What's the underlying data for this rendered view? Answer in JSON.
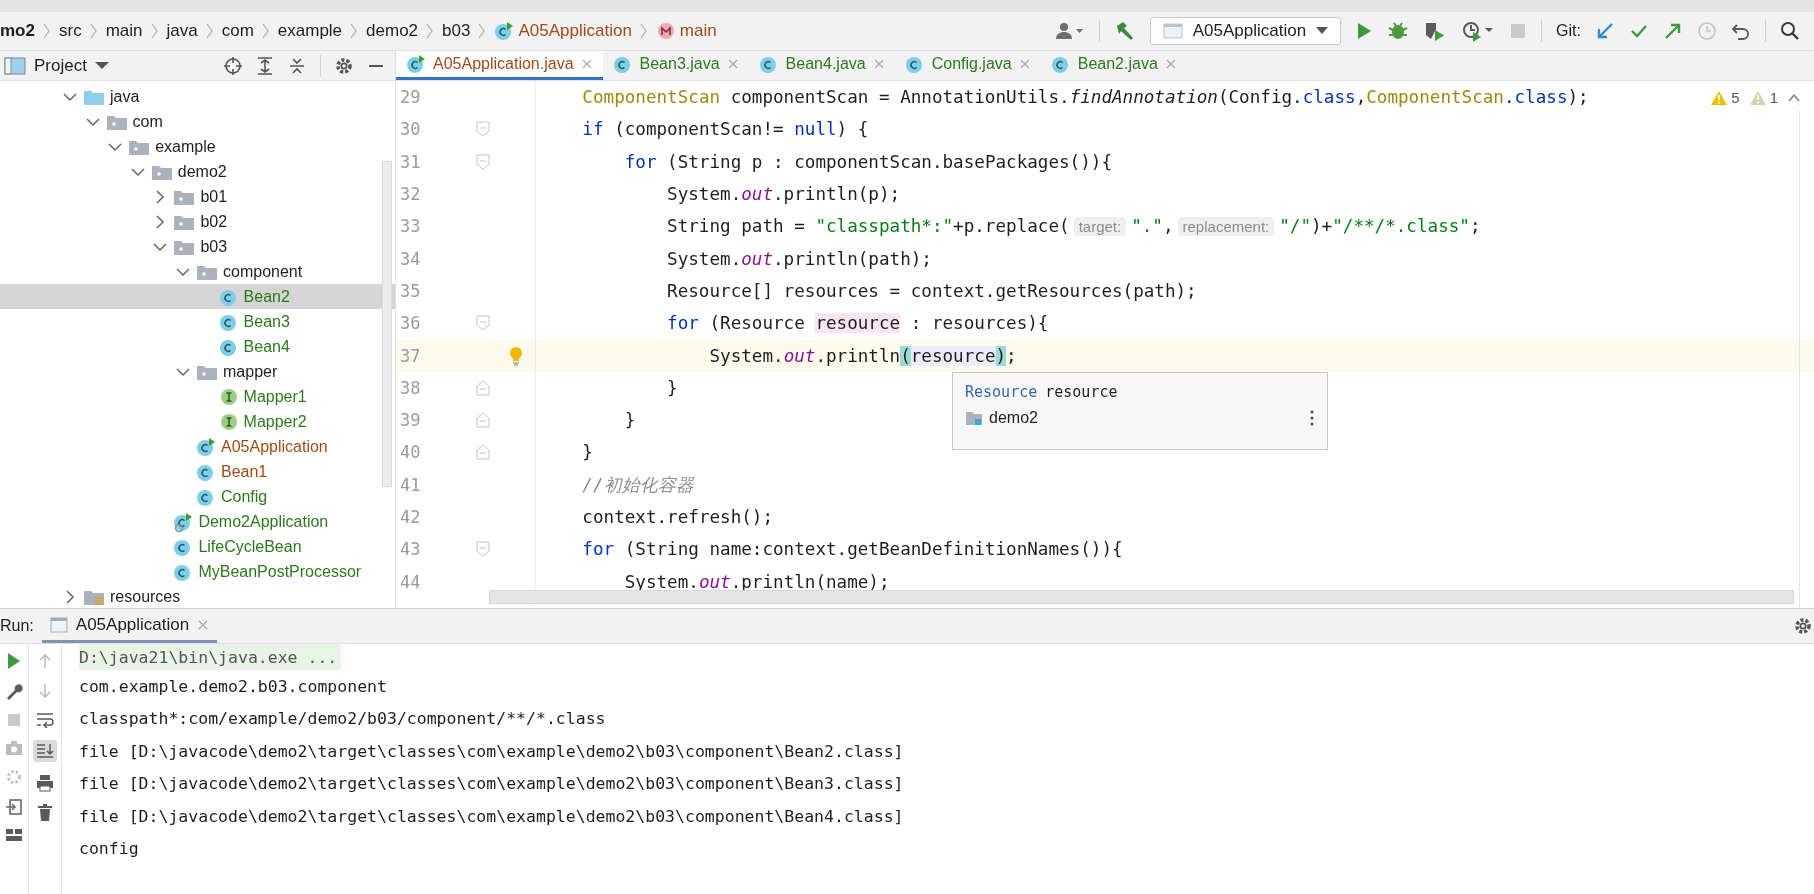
{
  "breadcrumbs": [
    {
      "label": "mo2",
      "kind": "module"
    },
    {
      "label": "src",
      "kind": "folder"
    },
    {
      "label": "main",
      "kind": "folder"
    },
    {
      "label": "java",
      "kind": "folder"
    },
    {
      "label": "com",
      "kind": "folder"
    },
    {
      "label": "example",
      "kind": "folder"
    },
    {
      "label": "demo2",
      "kind": "folder"
    },
    {
      "label": "b03",
      "kind": "folder"
    },
    {
      "label": "A05Application",
      "kind": "class"
    },
    {
      "label": "main",
      "kind": "method"
    }
  ],
  "toolbar": {
    "run_config": "A05Application",
    "git_label": "Git:"
  },
  "project_panel": {
    "title": "Project"
  },
  "tabs": [
    {
      "label": "A05Application.java",
      "selected": true,
      "color": "#a14a16"
    },
    {
      "label": "Bean3.java",
      "selected": false,
      "color": "#2a7a1a"
    },
    {
      "label": "Bean4.java",
      "selected": false,
      "color": "#2a7a1a"
    },
    {
      "label": "Config.java",
      "selected": false,
      "color": "#2a7a1a"
    },
    {
      "label": "Bean2.java",
      "selected": false,
      "color": "#2a7a1a"
    }
  ],
  "tree": [
    {
      "label": "java",
      "kind": "source-folder",
      "expanded": true,
      "selected": false,
      "children": [
        {
          "label": "com",
          "kind": "package",
          "expanded": true,
          "selected": false,
          "children": [
            {
              "label": "example",
              "kind": "package",
              "expanded": true,
              "selected": false,
              "children": [
                {
                  "label": "demo2",
                  "kind": "package",
                  "expanded": true,
                  "selected": false,
                  "children": [
                    {
                      "label": "b01",
                      "kind": "package",
                      "expanded": false,
                      "selected": false
                    },
                    {
                      "label": "b02",
                      "kind": "package",
                      "expanded": false,
                      "selected": false
                    },
                    {
                      "label": "b03",
                      "kind": "package",
                      "expanded": true,
                      "selected": false,
                      "children": [
                        {
                          "label": "component",
                          "kind": "package",
                          "expanded": true,
                          "selected": false,
                          "children": [
                            {
                              "label": "Bean2",
                              "kind": "class",
                              "color": "#2a7a1a",
                              "selected": true
                            },
                            {
                              "label": "Bean3",
                              "kind": "class",
                              "color": "#2a7a1a",
                              "selected": false
                            },
                            {
                              "label": "Bean4",
                              "kind": "class",
                              "color": "#2a7a1a",
                              "selected": false
                            }
                          ]
                        },
                        {
                          "label": "mapper",
                          "kind": "package",
                          "expanded": true,
                          "selected": false,
                          "children": [
                            {
                              "label": "Mapper1",
                              "kind": "interface",
                              "color": "#2a7a1a",
                              "selected": false
                            },
                            {
                              "label": "Mapper2",
                              "kind": "interface",
                              "color": "#2a7a1a",
                              "selected": false
                            }
                          ]
                        },
                        {
                          "label": "A05Application",
                          "kind": "main-class",
                          "color": "#a14a16",
                          "selected": false
                        },
                        {
                          "label": "Bean1",
                          "kind": "class",
                          "color": "#a14a16",
                          "selected": false
                        },
                        {
                          "label": "Config",
                          "kind": "class",
                          "color": "#2a7a1a",
                          "selected": false
                        }
                      ]
                    },
                    {
                      "label": "Demo2Application",
                      "kind": "boot-class",
                      "color": "#2a7a1a",
                      "selected": false
                    },
                    {
                      "label": "LifeCycleBean",
                      "kind": "class",
                      "color": "#2a7a1a",
                      "selected": false
                    },
                    {
                      "label": "MyBeanPostProcessor",
                      "kind": "class",
                      "color": "#2a7a1a",
                      "selected": false
                    }
                  ]
                }
              ]
            }
          ]
        }
      ]
    },
    {
      "label": "resources",
      "kind": "resources-folder",
      "expanded": false,
      "selected": false
    }
  ],
  "editor": {
    "inspections": [
      {
        "kind": "warning",
        "count": "5"
      },
      {
        "kind": "weak-warning",
        "count": "1"
      }
    ],
    "lines": [
      {
        "number": "29",
        "current": false,
        "fold_start": false,
        "fold_end": false,
        "tokens": [
          {
            "kind": "type",
            "text": "ComponentScan"
          },
          {
            "kind": "plain",
            "text": " componentScan = AnnotationUtils."
          },
          {
            "kind": "italic",
            "text": "findAnnotation"
          },
          {
            "kind": "plain",
            "text": "(Config."
          },
          {
            "kind": "keyword",
            "text": "class"
          },
          {
            "kind": "plain",
            "text": ","
          },
          {
            "kind": "type",
            "text": "ComponentScan"
          },
          {
            "kind": "plain",
            "text": "."
          },
          {
            "kind": "keyword",
            "text": "class"
          },
          {
            "kind": "plain",
            "text": ");"
          }
        ]
      },
      {
        "number": "30",
        "current": false,
        "fold_start": true,
        "fold_end": false,
        "tokens": [
          {
            "kind": "keyword",
            "text": "if"
          },
          {
            "kind": "plain",
            "text": " (componentScan!= "
          },
          {
            "kind": "keyword",
            "text": "null"
          },
          {
            "kind": "plain",
            "text": ") {"
          }
        ]
      },
      {
        "number": "31",
        "current": false,
        "fold_start": true,
        "fold_end": false,
        "tokens": [
          {
            "kind": "keyword",
            "text": "for"
          },
          {
            "kind": "plain",
            "text": " (String p : componentScan.basePackages()){"
          }
        ]
      },
      {
        "number": "32",
        "current": false,
        "fold_start": false,
        "fold_end": false,
        "tokens": [
          {
            "kind": "plain",
            "text": "System."
          },
          {
            "kind": "static",
            "text": "out"
          },
          {
            "kind": "plain",
            "text": ".println(p);"
          }
        ]
      },
      {
        "number": "33",
        "current": false,
        "fold_start": false,
        "fold_end": false,
        "tokens": [
          {
            "kind": "plain",
            "text": "String path = "
          },
          {
            "kind": "string",
            "text": "\"classpath*:\""
          },
          {
            "kind": "plain",
            "text": "+p.replace("
          },
          {
            "kind": "hint",
            "text": "target:"
          },
          {
            "kind": "string",
            "text": "\".\""
          },
          {
            "kind": "plain",
            "text": ","
          },
          {
            "kind": "hint",
            "text": "replacement:"
          },
          {
            "kind": "string",
            "text": "\"/\""
          },
          {
            "kind": "plain",
            "text": ")+"
          },
          {
            "kind": "string",
            "text": "\"/**/*.class\""
          },
          {
            "kind": "plain",
            "text": ";"
          }
        ]
      },
      {
        "number": "34",
        "current": false,
        "fold_start": false,
        "fold_end": false,
        "tokens": [
          {
            "kind": "plain",
            "text": "System."
          },
          {
            "kind": "static",
            "text": "out"
          },
          {
            "kind": "plain",
            "text": ".println(path);"
          }
        ]
      },
      {
        "number": "35",
        "current": false,
        "fold_start": false,
        "fold_end": false,
        "tokens": [
          {
            "kind": "plain",
            "text": "Resource[] resources = context.getResources(path);"
          }
        ]
      },
      {
        "number": "36",
        "current": false,
        "fold_start": true,
        "fold_end": false,
        "tokens": [
          {
            "kind": "keyword",
            "text": "for"
          },
          {
            "kind": "plain",
            "text": " (Resource "
          },
          {
            "kind": "write",
            "text": "resource"
          },
          {
            "kind": "plain",
            "text": " : resources){"
          }
        ]
      },
      {
        "number": "37",
        "current": true,
        "fold_start": false,
        "fold_end": false,
        "tokens": [
          {
            "kind": "plain",
            "text": "System."
          },
          {
            "kind": "static",
            "text": "out"
          },
          {
            "kind": "plain",
            "text": ".println"
          },
          {
            "kind": "brace",
            "text": "("
          },
          {
            "kind": "read",
            "text": "resource"
          },
          {
            "kind": "brace",
            "text": ")"
          },
          {
            "kind": "plain",
            "text": ";"
          }
        ]
      },
      {
        "number": "38",
        "current": false,
        "fold_start": false,
        "fold_end": true,
        "tokens": [
          {
            "kind": "plain",
            "text": "}"
          }
        ]
      },
      {
        "number": "39",
        "current": false,
        "fold_start": false,
        "fold_end": true,
        "tokens": [
          {
            "kind": "plain",
            "text": "}"
          }
        ]
      },
      {
        "number": "40",
        "current": false,
        "fold_start": false,
        "fold_end": true,
        "tokens": [
          {
            "kind": "plain",
            "text": "}"
          }
        ]
      },
      {
        "number": "41",
        "current": false,
        "fold_start": false,
        "fold_end": false,
        "tokens": [
          {
            "kind": "comment",
            "text": "//初始化容器"
          }
        ]
      },
      {
        "number": "42",
        "current": false,
        "fold_start": false,
        "fold_end": false,
        "tokens": [
          {
            "kind": "plain",
            "text": "context.refresh();"
          }
        ]
      },
      {
        "number": "43",
        "current": false,
        "fold_start": true,
        "fold_end": false,
        "tokens": [
          {
            "kind": "keyword",
            "text": "for"
          },
          {
            "kind": "plain",
            "text": " (String name:context.getBeanDefinitionNames()){"
          }
        ]
      },
      {
        "number": "44",
        "current": false,
        "fold_start": false,
        "fold_end": false,
        "tokens": [
          {
            "kind": "plain",
            "text": "System."
          },
          {
            "kind": "static",
            "text": "out"
          },
          {
            "kind": "plain",
            "text": ".println(name);"
          }
        ]
      }
    ],
    "tooltip": {
      "type": "Resource",
      "name": "resource",
      "location": "demo2"
    }
  },
  "run_panel": {
    "label": "Run:",
    "tab": {
      "label": "A05Application",
      "selected": true
    },
    "scroll_to_end": true,
    "output": [
      {
        "kind": "command",
        "text": "D:\\java21\\bin\\java.exe ..."
      },
      {
        "kind": "stdout",
        "text": "com.example.demo2.b03.component"
      },
      {
        "kind": "stdout",
        "text": "classpath*:com/example/demo2/b03/component/**/*.class"
      },
      {
        "kind": "stdout",
        "text": "file [D:\\javacode\\demo2\\target\\classes\\com\\example\\demo2\\b03\\component\\Bean2.class]"
      },
      {
        "kind": "stdout",
        "text": "file [D:\\javacode\\demo2\\target\\classes\\com\\example\\demo2\\b03\\component\\Bean3.class]"
      },
      {
        "kind": "stdout",
        "text": "file [D:\\javacode\\demo2\\target\\classes\\com\\example\\demo2\\b03\\component\\Bean4.class]"
      },
      {
        "kind": "stdout",
        "text": "config"
      }
    ]
  }
}
